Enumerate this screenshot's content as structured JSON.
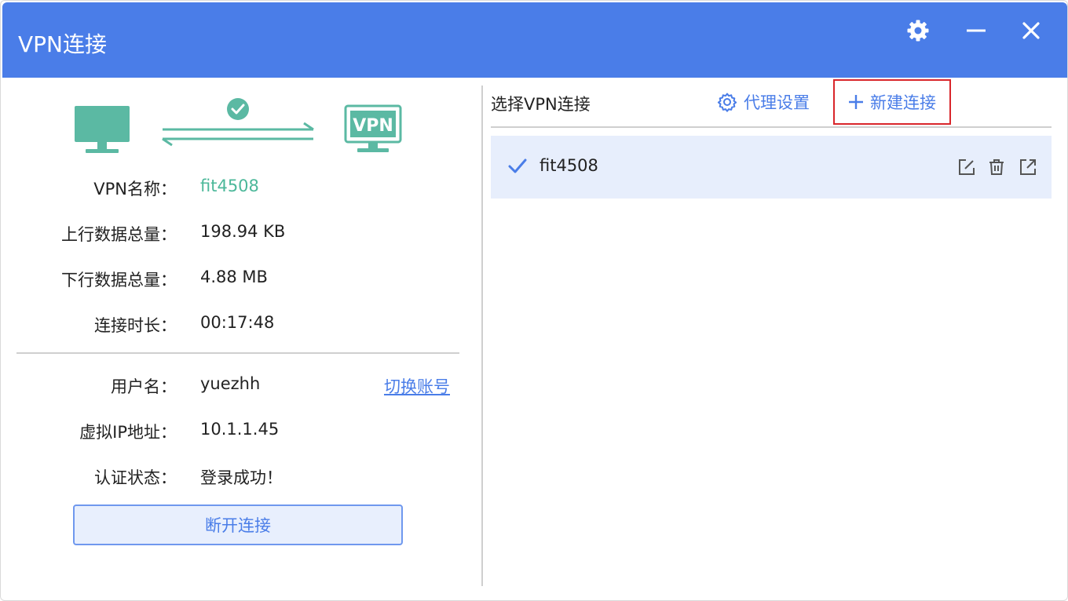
{
  "window": {
    "title": "VPN连接"
  },
  "colors": {
    "titlebar": "#4a7de8",
    "accent_blue": "#4a7de8",
    "accent_green": "#4cb89a",
    "highlight_red": "#d9262b"
  },
  "status_graphic": {
    "left_icon": "monitor-icon",
    "middle_icon": "check-circle-icon",
    "right_icon": "vpn-monitor-icon",
    "vpn_badge_text": "VPN"
  },
  "info": {
    "vpn_name_label": "VPN名称：",
    "vpn_name_value": "fit4508",
    "upload_label": "上行数据总量：",
    "upload_value": "198.94 KB",
    "download_label": "下行数据总量：",
    "download_value": "4.88 MB",
    "duration_label": "连接时长：",
    "duration_value": "00:17:48",
    "username_label": "用户名：",
    "username_value": "yuezhh",
    "switch_account": "切换账号",
    "virtual_ip_label": "虚拟IP地址：",
    "virtual_ip_value": "10.1.1.45",
    "auth_status_label": "认证状态：",
    "auth_status_value": "登录成功！"
  },
  "buttons": {
    "disconnect": "断开连接"
  },
  "right_panel": {
    "header_label": "选择VPN连接",
    "proxy_settings": "代理设置",
    "new_connection": "新建连接",
    "connections": [
      {
        "name": "fit4508",
        "selected": true
      }
    ]
  }
}
